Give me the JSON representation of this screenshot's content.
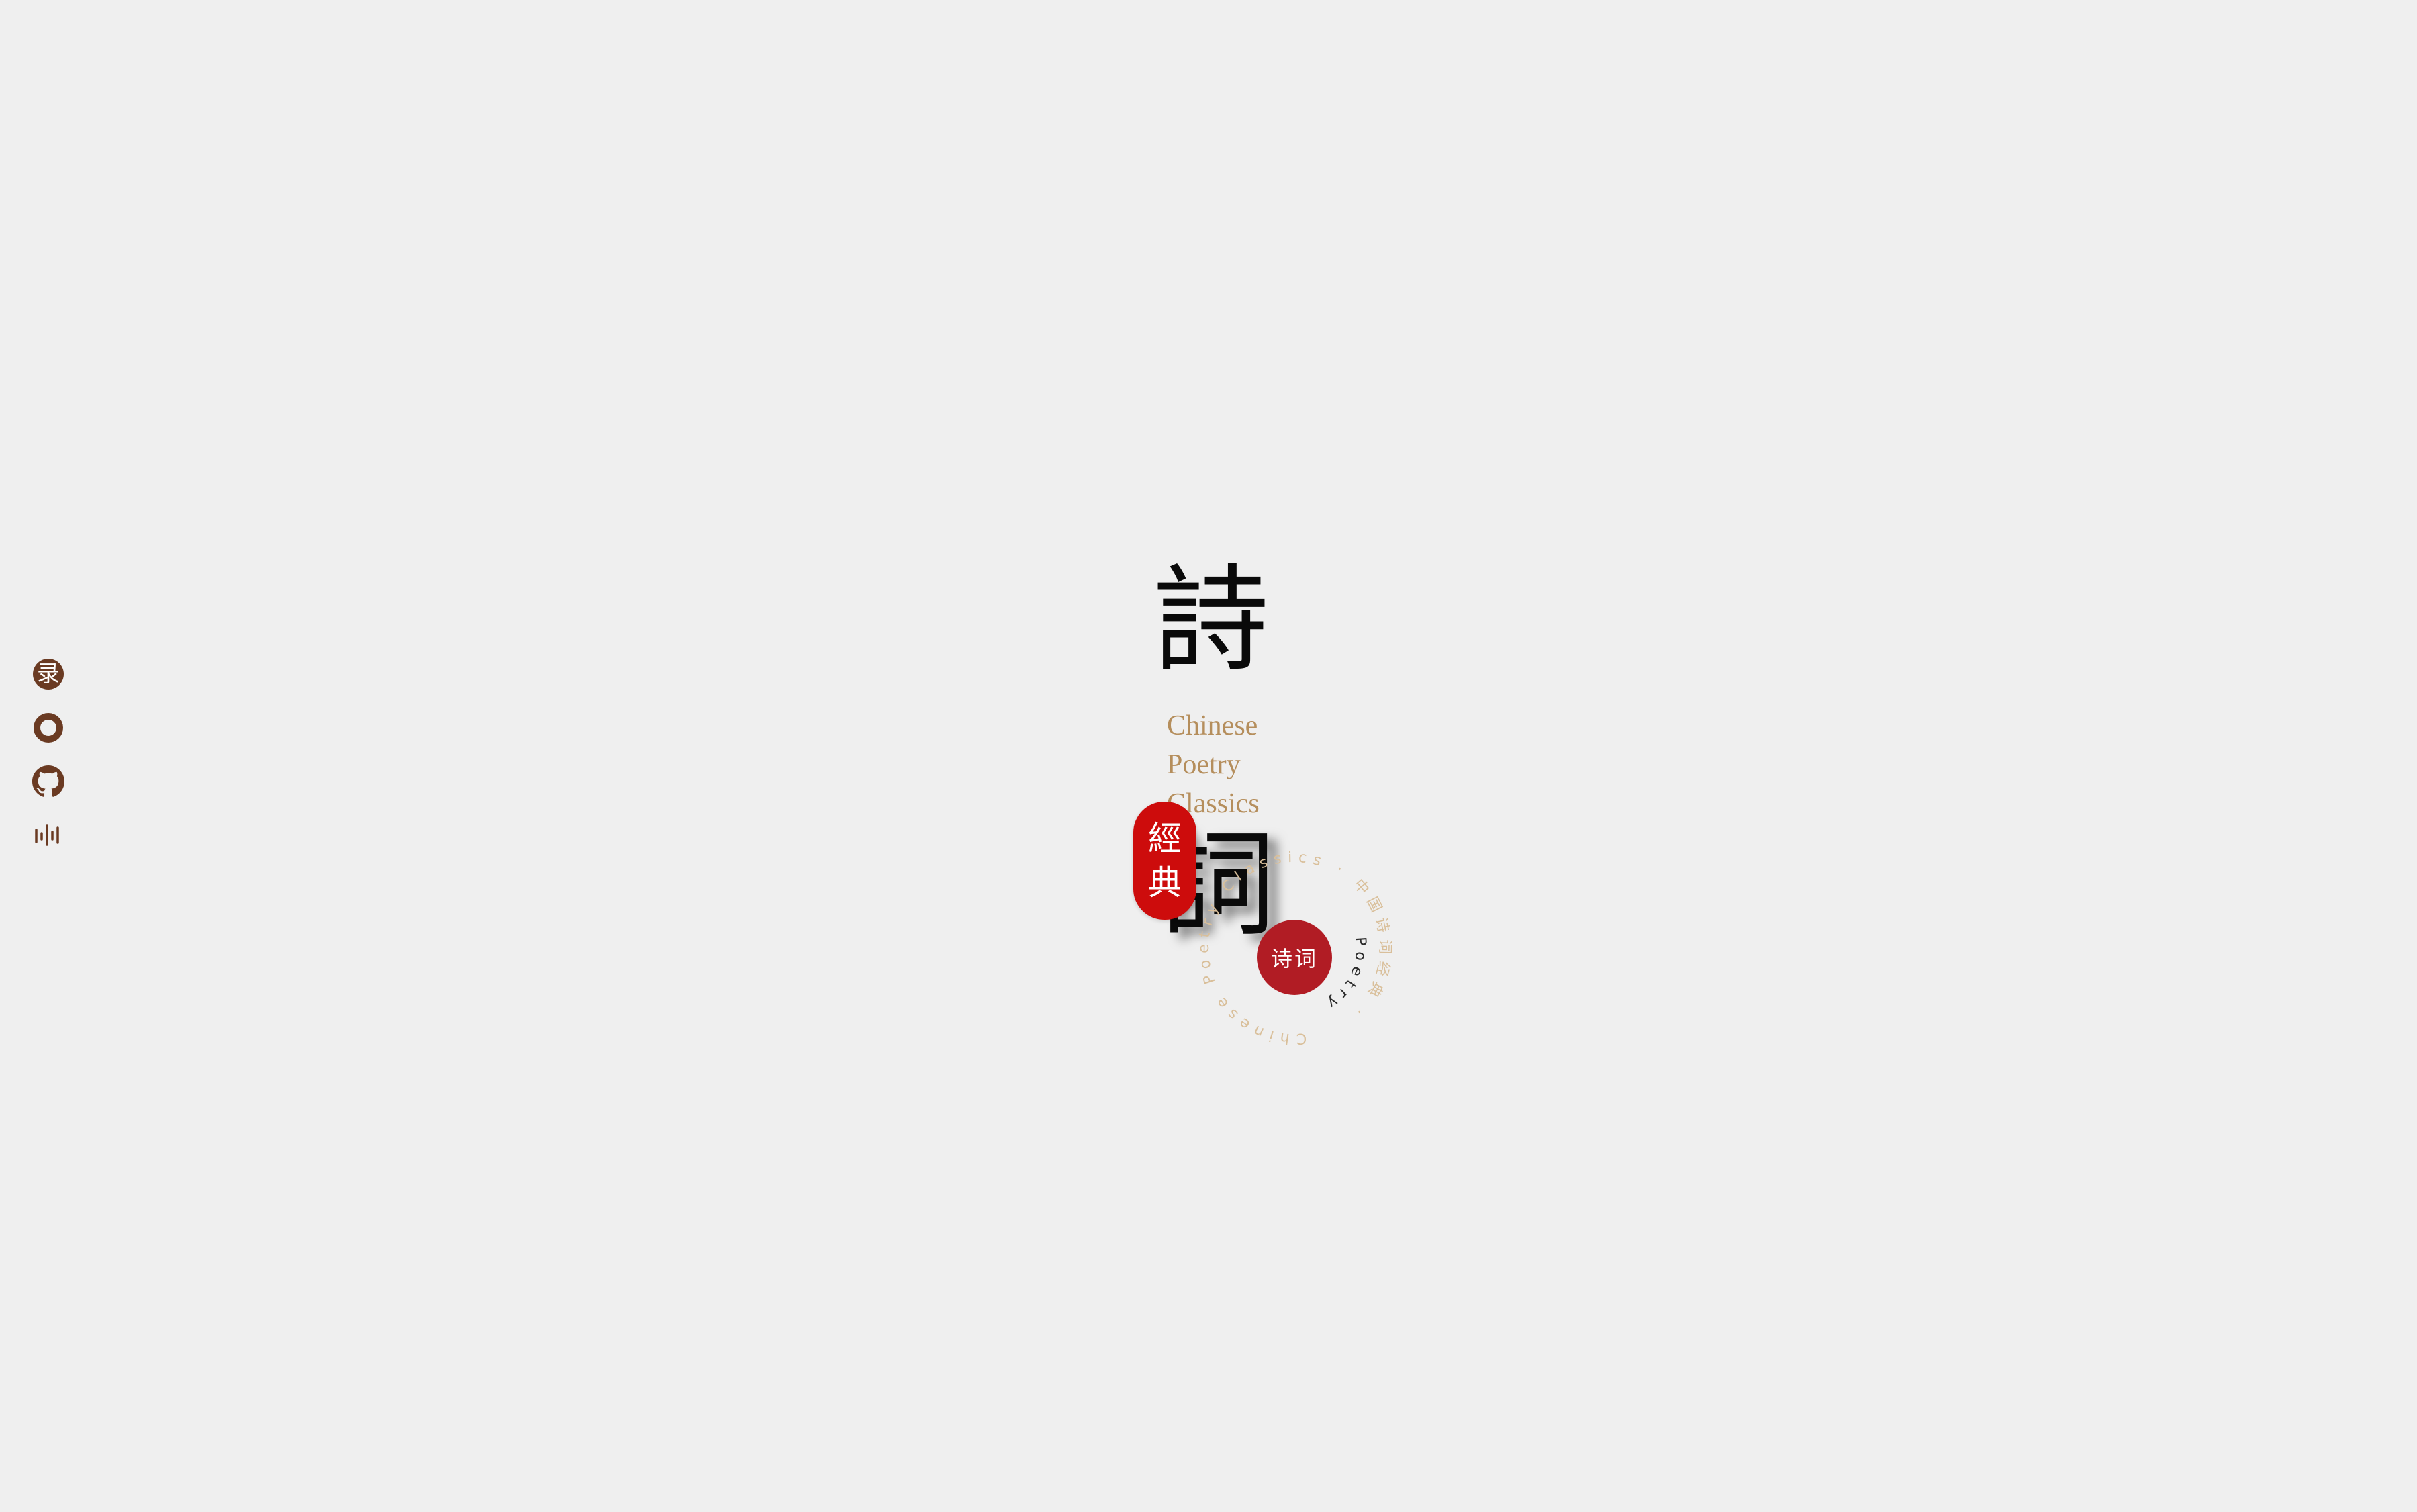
{
  "sidebar": {
    "items": [
      {
        "name": "lu",
        "label": "录",
        "icon": "lu-seal-icon"
      },
      {
        "name": "circle",
        "icon": "ring-icon"
      },
      {
        "name": "github",
        "icon": "github-icon"
      },
      {
        "name": "wave",
        "icon": "sound-wave-icon"
      }
    ]
  },
  "hero": {
    "title_top": "詩",
    "title_bottom": "詞",
    "subtitle_lines": [
      "Chinese",
      "Poetry",
      "Classics"
    ],
    "seal_chars": [
      "經",
      "典"
    ]
  },
  "ring": {
    "outer_text": "Chinese Poetry Classics · 中国诗词经典 ·",
    "inner_text": "Poetry"
  },
  "badge": {
    "label": "诗词"
  },
  "colors": {
    "background": "#efefef",
    "seal_red": "#cd0c0c",
    "badge_red": "#b11c24",
    "gold": "#b58e5c",
    "sidebar_brown": "#6a3a22",
    "ink": "#0a0a0a"
  }
}
